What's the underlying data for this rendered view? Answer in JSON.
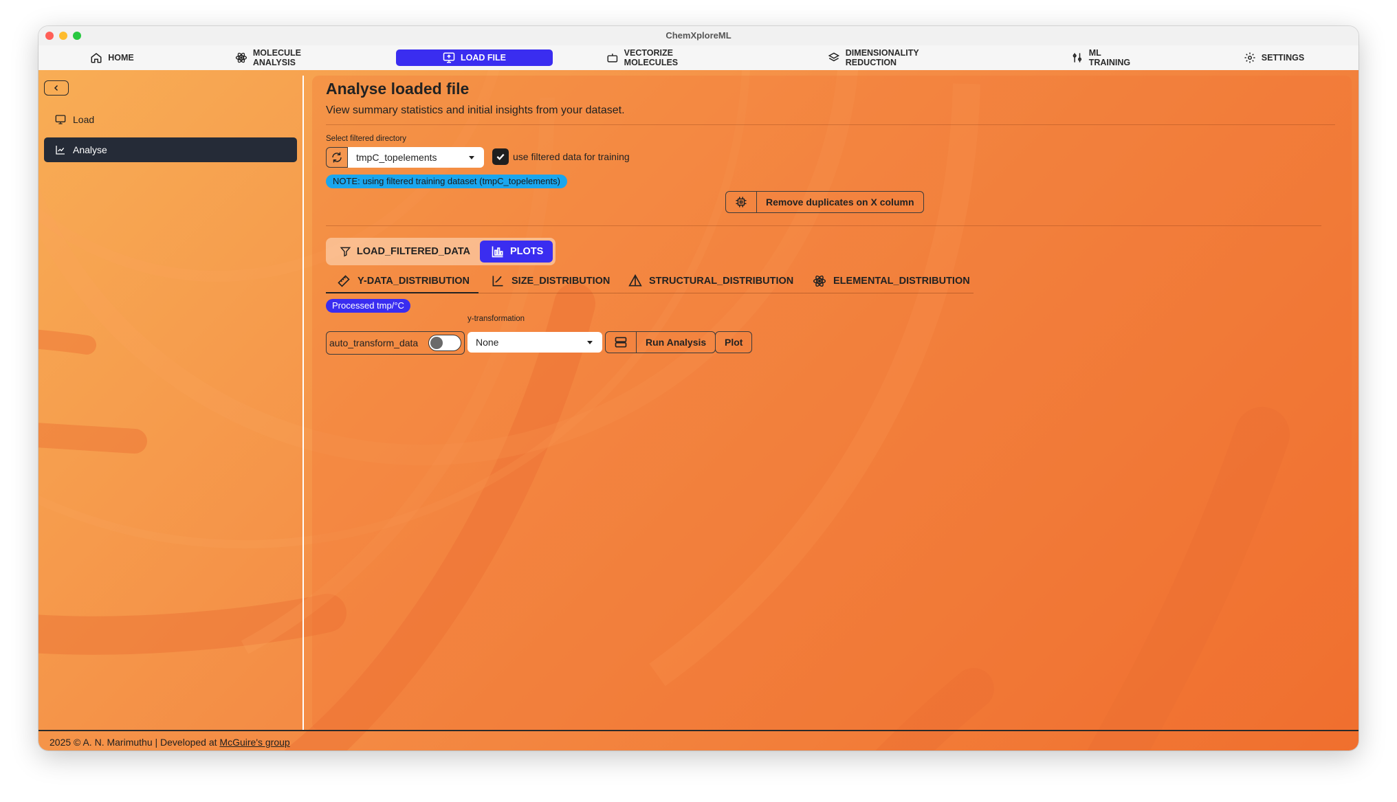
{
  "window": {
    "title": "ChemXploreML"
  },
  "nav": {
    "items": [
      {
        "label": "HOME",
        "icon": "home-icon"
      },
      {
        "label": "MOLECULE ANALYSIS",
        "icon": "atom-icon"
      },
      {
        "label": "LOAD FILE",
        "icon": "monitor-upload-icon",
        "active": true
      },
      {
        "label": "VECTORIZE MOLECULES",
        "icon": "robot-icon"
      },
      {
        "label": "DIMENSIONALITY REDUCTION",
        "icon": "layers-icon"
      },
      {
        "label": "ML TRAINING",
        "icon": "sliders-icon"
      },
      {
        "label": "SETTINGS",
        "icon": "gear-icon"
      }
    ]
  },
  "sidebar": {
    "items": [
      {
        "label": "Load",
        "icon": "monitor-icon"
      },
      {
        "label": "Analyse",
        "icon": "chart-icon",
        "active": true
      }
    ]
  },
  "main": {
    "title": "Analyse loaded file",
    "subtitle": "View summary statistics and initial insights from your dataset.",
    "filtered_dir_label": "Select filtered directory",
    "filtered_dir_value": "tmpC_topelements",
    "use_filtered_label": "use filtered data for training",
    "use_filtered_checked": true,
    "note": "NOTE: using filtered training dataset (tmpC_topelements)",
    "remove_duplicates_label": "Remove duplicates on X column",
    "segments": [
      {
        "label": "LOAD_FILTERED_DATA",
        "icon": "filter-icon"
      },
      {
        "label": "PLOTS",
        "icon": "chart-bars-icon",
        "active": true
      }
    ],
    "tabs": [
      {
        "label": "Y-DATA_DISTRIBUTION",
        "icon": "ruler-icon",
        "active": true
      },
      {
        "label": "SIZE_DISTRIBUTION",
        "icon": "axis-icon"
      },
      {
        "label": "STRUCTURAL_DISTRIBUTION",
        "icon": "pyramid-icon"
      },
      {
        "label": "ELEMENTAL_DISTRIBUTION",
        "icon": "atom-icon"
      }
    ],
    "processed_badge": "Processed tmp/°C",
    "auto_transform_label": "auto_transform_data",
    "auto_transform_on": false,
    "y_transformation_label": "y-transformation",
    "y_transformation_value": "None",
    "run_analysis_label": "Run Analysis",
    "plot_label": "Plot"
  },
  "footer": {
    "text": "2025 © A. N. Marimuthu | Developed at ",
    "link": "McGuire's group"
  },
  "colors": {
    "accent": "#3a2df0",
    "note": "#1aa6ee",
    "sidebar_active": "#252b37"
  }
}
